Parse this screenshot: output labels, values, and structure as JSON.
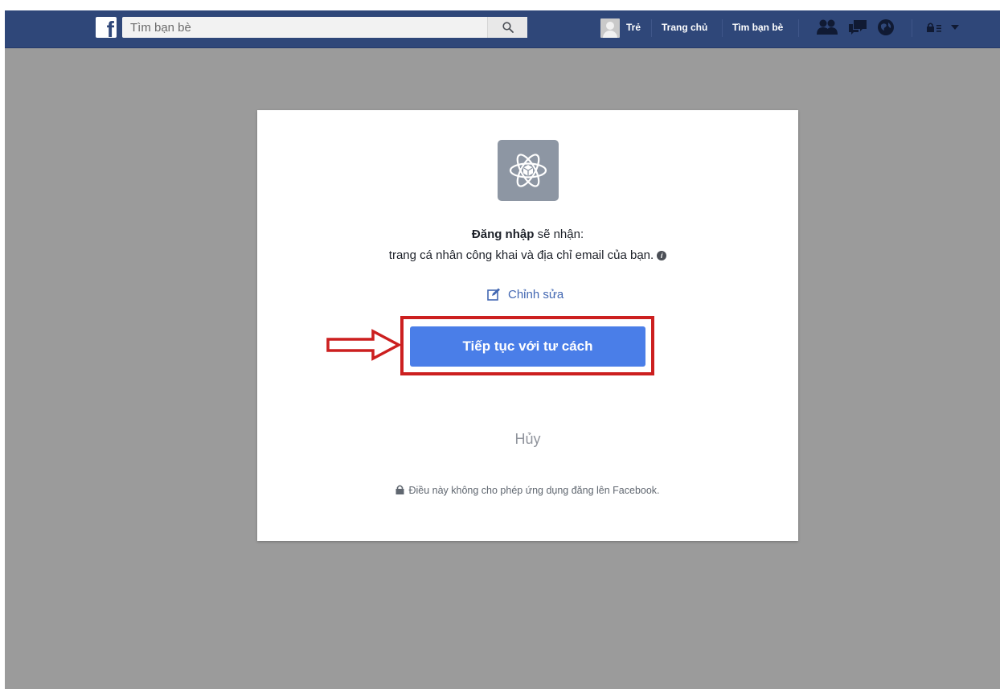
{
  "colors": {
    "topbar": "#2f4779",
    "overlay": "#9b9b9b",
    "primary_button": "#4a7ee8",
    "highlight": "#cc1f1f",
    "link": "#4267b2"
  },
  "header": {
    "logo_letter": "f",
    "search_placeholder": "Tìm bạn bè",
    "user_name": "Trẻ",
    "home_label": "Trang chủ",
    "find_friends_label": "Tìm bạn bè",
    "icons": [
      "friend-requests-icon",
      "messages-icon",
      "notifications-globe-icon",
      "privacy-lock-icon",
      "account-menu-chevron-icon"
    ]
  },
  "dialog": {
    "app_icon": "atom-cube-icon",
    "perm_app_name": "Đăng nhập",
    "perm_suffix": "sẽ nhận:",
    "perm_details": "trang cá nhân công khai và địa chỉ email của bạn.",
    "info_icon_glyph": "i",
    "edit_label": "Chỉnh sửa",
    "continue_label": "Tiếp tục với tư cách",
    "cancel_label": "Hủy",
    "footer_note": "Điều này không cho phép ứng dụng đăng lên Facebook."
  }
}
